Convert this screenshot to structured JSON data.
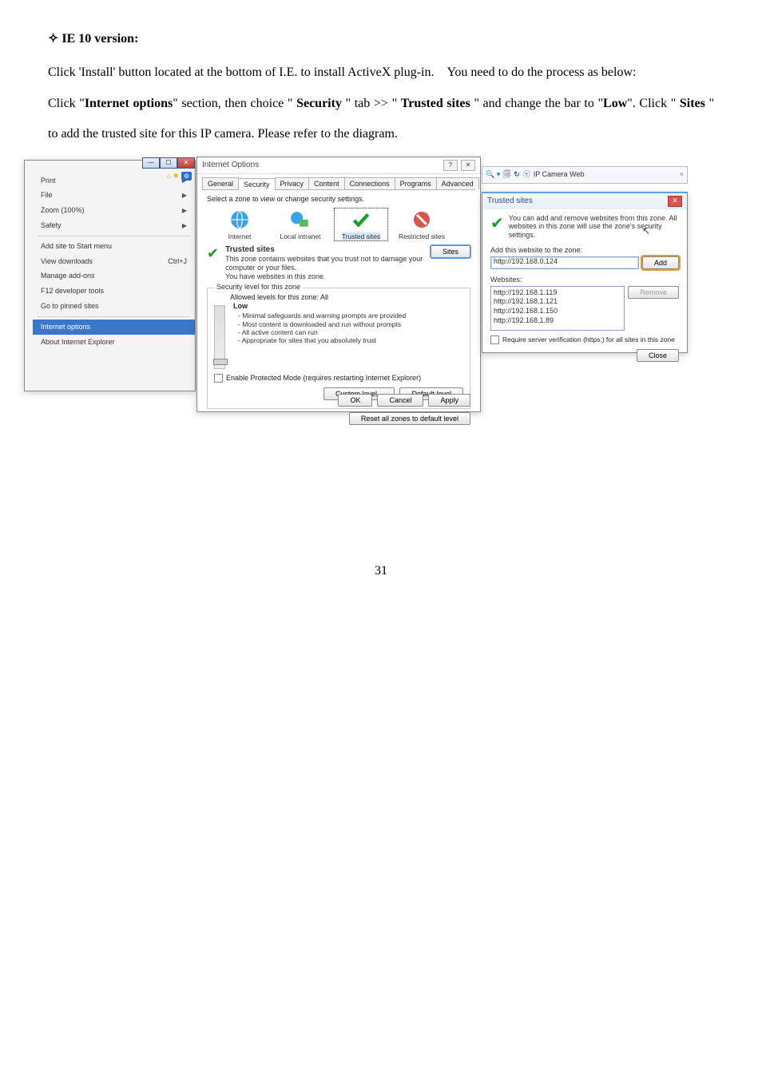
{
  "heading": "IE 10 version:",
  "diamond": "✧",
  "p1_a": "Click 'Install' button located at the bottom of I.E. to install ActiveX plug-in.",
  "p1_b": "You need to do the process as below:",
  "p2_a": "Click \"",
  "p2_internet_options": "Internet options",
  "p2_b": "\" section, then choice \" ",
  "p2_security": "Security",
  "p2_c": " \" tab >> \" ",
  "p2_trusted_sites_span": "Trusted sites",
  "p2_d": " \" and change the bar to \"",
  "p2_low": "Low",
  "p2_e": "\".    Click \" ",
  "p2_sites": "Sites",
  "p2_f": " \" to add the trusted site for this IP camera.    Please refer to the diagram.",
  "tools": {
    "items": [
      "Print",
      "File",
      "Zoom (100%)",
      "Safety",
      "Add site to Start menu",
      "View downloads",
      "Manage add-ons",
      "F12 developer tools",
      "Go to pinned sites",
      "Internet options",
      "About Internet Explorer"
    ],
    "shortcut_view_downloads": "Ctrl+J"
  },
  "io": {
    "title": "Internet Options",
    "tabs": [
      "General",
      "Security",
      "Privacy",
      "Content",
      "Connections",
      "Programs",
      "Advanced"
    ],
    "select_zone_label": "Select a zone to view or change security settings.",
    "zones": [
      "Internet",
      "Local intranet",
      "Trusted sites",
      "Restricted sites"
    ],
    "zone_title": "Trusted sites",
    "zone_desc1": "This zone contains websites that you trust not to damage your computer or your files.",
    "zone_desc2": "You have websites in this zone.",
    "sites_btn": "Sites",
    "sec_group_label": "Security level for this zone",
    "allowed": "Allowed levels for this zone: All",
    "level_name": "Low",
    "level_bullets": [
      "Minimal safeguards and warning prompts are provided",
      "Most content is downloaded and run without prompts",
      "All active content can run",
      "Appropriate for sites that you absolutely trust"
    ],
    "protected_mode": "Enable Protected Mode (requires restarting Internet Explorer)",
    "custom_level": "Custom level...",
    "default_level": "Default level",
    "reset_all": "Reset all zones to default level",
    "ok": "OK",
    "cancel": "Cancel",
    "apply": "Apply"
  },
  "browser": {
    "favicons": "🔍 ▾  🗐 ↻",
    "tab_title": "IP Camera Web",
    "close": "×"
  },
  "ts": {
    "title": "Trusted sites",
    "intro": "You can add and remove websites from this zone. All websites in this zone will use the zone's security settings.",
    "add_label": "Add this website to the zone:",
    "add_value": "http://192.168.0.124",
    "add_btn": "Add",
    "websites_label": "Websites:",
    "websites": [
      "http://192.168.1.119",
      "http://192.168.1.121",
      "http://192.168.1.150",
      "http://192.168.1.89"
    ],
    "remove_btn": "Remove",
    "require_https": "Require server verification (https:) for all sites in this zone",
    "close_btn": "Close",
    "xbtn": "✕"
  },
  "page_num": "31"
}
